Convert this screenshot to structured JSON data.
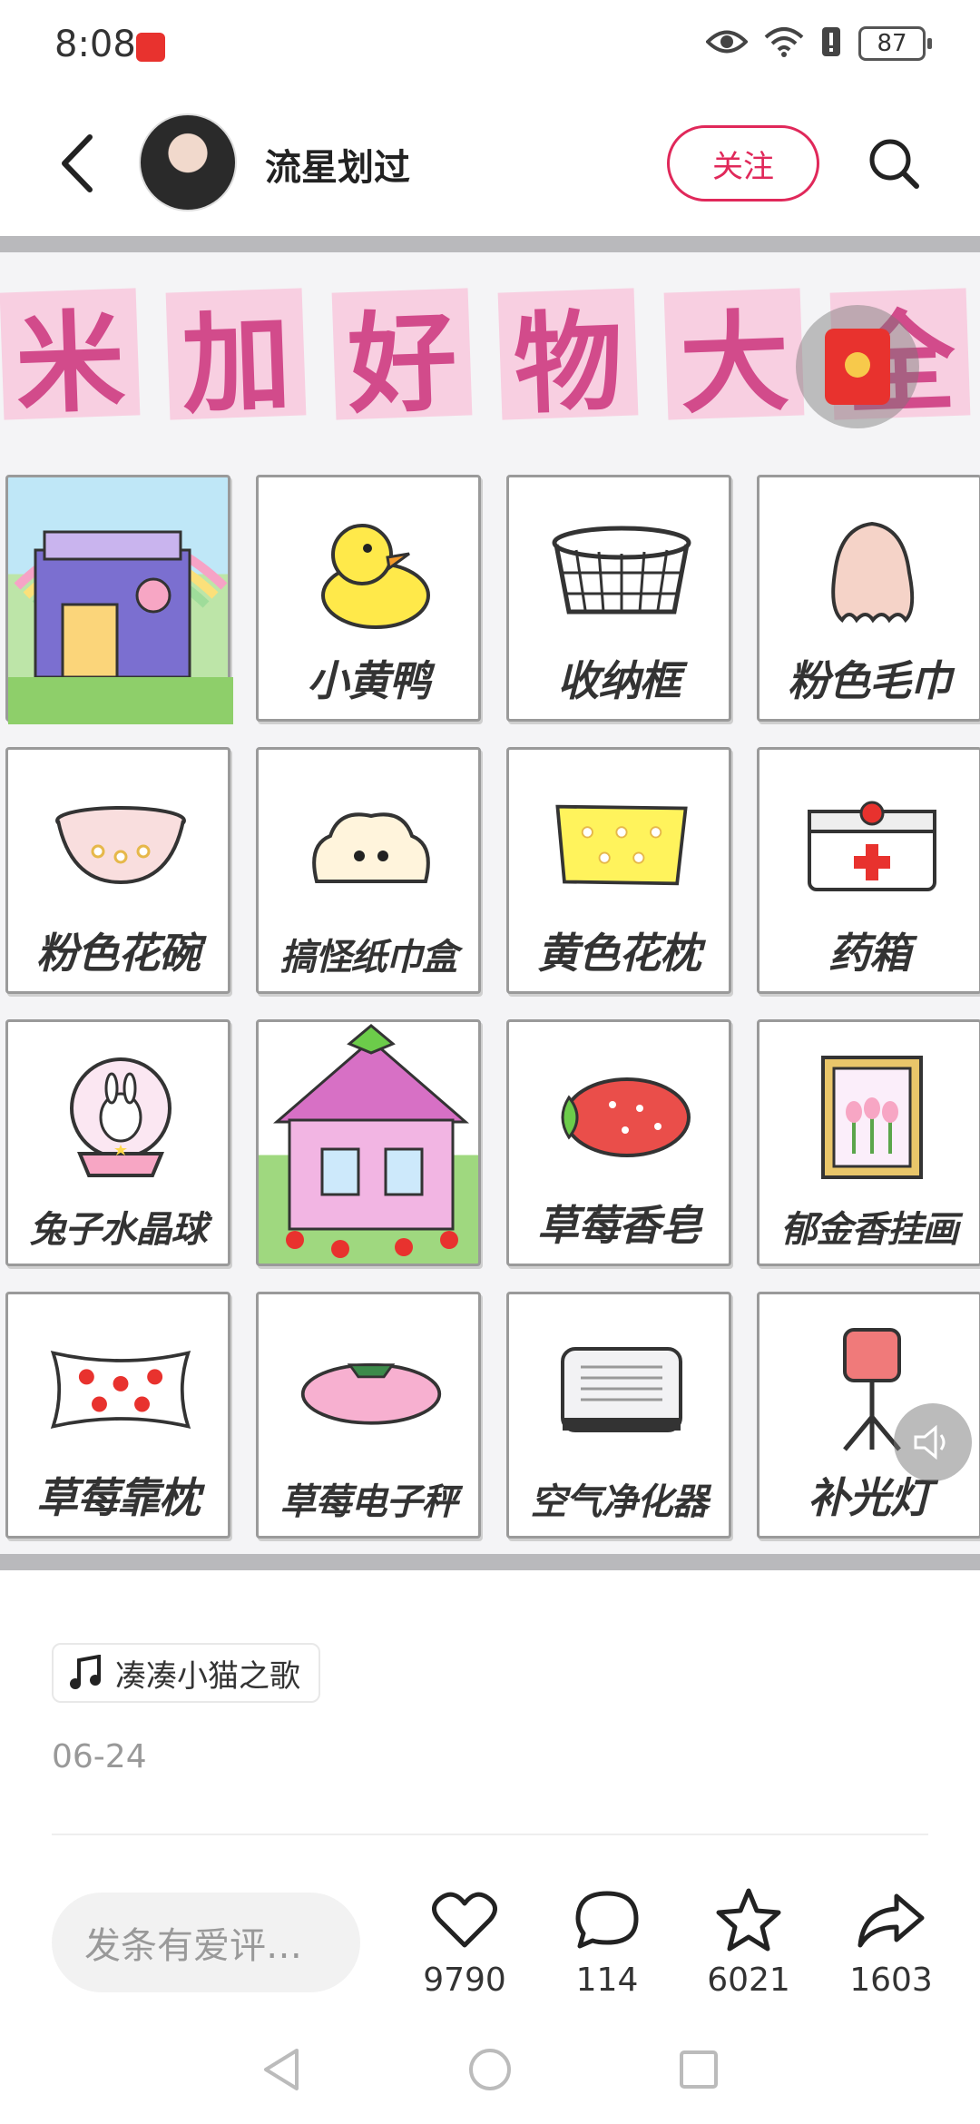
{
  "status_bar": {
    "time": "8:08",
    "battery": "87"
  },
  "header": {
    "author_name": "流星划过",
    "follow_label": "关注"
  },
  "post_image": {
    "banner_chars": [
      "米",
      "加",
      "好",
      "物",
      "大",
      "全"
    ],
    "items": [
      {
        "label": "",
        "icon": "building-house"
      },
      {
        "label": "小黄鸭",
        "icon": "duck-icon"
      },
      {
        "label": "收纳框",
        "icon": "basket-icon"
      },
      {
        "label": "粉色毛巾",
        "icon": "towel-icon"
      },
      {
        "label": "粉色花碗",
        "icon": "bowl-icon"
      },
      {
        "label": "搞怪纸巾盒",
        "icon": "tissue-box-icon"
      },
      {
        "label": "黄色花枕",
        "icon": "pillow-icon"
      },
      {
        "label": "药箱",
        "icon": "medkit-icon"
      },
      {
        "label": "兔子水晶球",
        "icon": "snow-globe-icon"
      },
      {
        "label": "",
        "icon": "strawberry-house"
      },
      {
        "label": "草莓香皂",
        "icon": "soap-icon"
      },
      {
        "label": "郁金香挂画",
        "icon": "painting-icon"
      },
      {
        "label": "草莓靠枕",
        "icon": "cushion-icon"
      },
      {
        "label": "草莓电子秤",
        "icon": "scale-icon"
      },
      {
        "label": "空气净化器",
        "icon": "air-purifier-icon"
      },
      {
        "label": "补光灯",
        "icon": "ring-light-icon"
      }
    ]
  },
  "music": {
    "label": "凑凑小猫之歌"
  },
  "post_date": "06-24",
  "bottom_bar": {
    "comment_placeholder": "发条有爱评…",
    "likes": "9790",
    "comments": "114",
    "favorites": "6021",
    "shares": "1603"
  },
  "colors": {
    "accent": "#e0285a",
    "banner_bg": "#f8cfe1",
    "banner_text": "#d24b8b"
  }
}
